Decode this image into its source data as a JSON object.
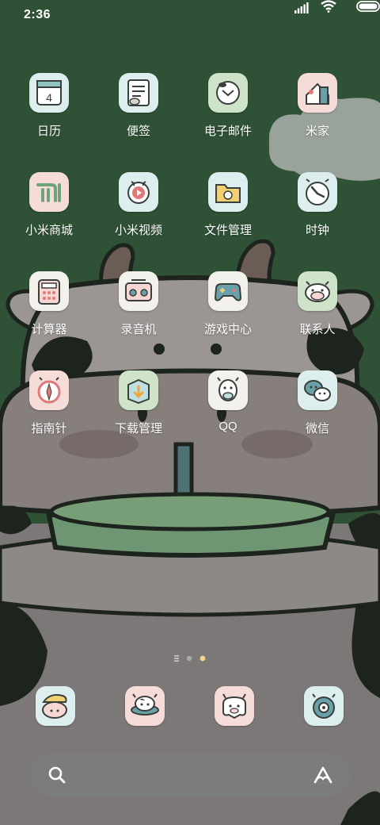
{
  "status_bar": {
    "time": "2:36"
  },
  "apps": [
    {
      "label": "日历",
      "icon": "calendar-icon",
      "tile_color": "#dcefee",
      "calendar_day": "4"
    },
    {
      "label": "便签",
      "icon": "notes-icon",
      "tile_color": "#dcefee"
    },
    {
      "label": "电子邮件",
      "icon": "email-icon",
      "tile_color": "#cfe3c8"
    },
    {
      "label": "米家",
      "icon": "mijia-home-icon",
      "tile_color": "#f6dcd8"
    },
    {
      "label": "小米商城",
      "icon": "mi-store-icon",
      "tile_color": "#f6dcd8"
    },
    {
      "label": "小米视频",
      "icon": "video-icon",
      "tile_color": "#dcefee"
    },
    {
      "label": "文件管理",
      "icon": "folder-icon",
      "tile_color": "#dcefee"
    },
    {
      "label": "时钟",
      "icon": "clock-icon",
      "tile_color": "#dcefee"
    },
    {
      "label": "计算器",
      "icon": "calculator-icon",
      "tile_color": "#f2f1ec"
    },
    {
      "label": "录音机",
      "icon": "recorder-icon",
      "tile_color": "#f2f1ec"
    },
    {
      "label": "游戏中心",
      "icon": "gamepad-icon",
      "tile_color": "#f2f1ec"
    },
    {
      "label": "联系人",
      "icon": "contacts-cow-icon",
      "tile_color": "#cfe3c8"
    },
    {
      "label": "指南针",
      "icon": "compass-icon",
      "tile_color": "#f6dcd8"
    },
    {
      "label": "下载管理",
      "icon": "download-icon",
      "tile_color": "#cfe3c8"
    },
    {
      "label": "QQ",
      "icon": "qq-icon",
      "tile_color": "#f2f1ec"
    },
    {
      "label": "微信",
      "icon": "wechat-icon",
      "tile_color": "#dcefee"
    }
  ],
  "page_indicator": {
    "pages": 3,
    "current": 3
  },
  "dock": [
    {
      "icon": "phone-cow-icon",
      "tile_color": "#dcefee"
    },
    {
      "icon": "messages-cow-icon",
      "tile_color": "#f6dcd8"
    },
    {
      "icon": "camera-cow-icon",
      "tile_color": "#f6dcd8"
    },
    {
      "icon": "browser-cow-icon",
      "tile_color": "#dcefee"
    }
  ],
  "search": {
    "icon": "search-icon",
    "assistant_icon": "assistant-icon"
  },
  "colors": {
    "wallpaper_green": "#2f5236",
    "cow_gray": "#7d7878",
    "pot_green": "#6e9672",
    "dark_ink": "#1d231d"
  }
}
